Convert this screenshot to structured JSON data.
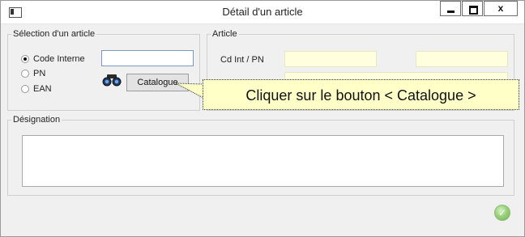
{
  "window": {
    "title": "Détail d'un article",
    "close_label": "x"
  },
  "selection_group": {
    "label": "Sélection d'un article",
    "options": [
      {
        "label": "Code Interne",
        "checked": true
      },
      {
        "label": "PN",
        "checked": false
      },
      {
        "label": "EAN",
        "checked": false
      }
    ],
    "code_value": "",
    "catalogue_button": "Catalogue",
    "search_icon": "binoculars-icon"
  },
  "article_group": {
    "label": "Article",
    "field_label": "Cd Int / PN",
    "value1": "",
    "value2": ""
  },
  "designation_group": {
    "label": "Désignation",
    "text": ""
  },
  "tooltip": {
    "text": "Cliquer sur le bouton < Catalogue >"
  },
  "footer": {
    "ok_icon": "green-check-icon"
  }
}
